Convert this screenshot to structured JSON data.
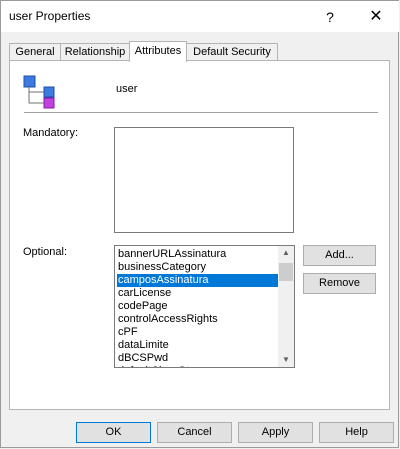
{
  "window": {
    "title": "user Properties",
    "help_glyph": "?",
    "close_glyph": "✕"
  },
  "tabs": [
    {
      "label": "General"
    },
    {
      "label": "Relationship"
    },
    {
      "label": "Attributes",
      "active": true
    },
    {
      "label": "Default Security"
    }
  ],
  "object": {
    "name": "user",
    "icon": "class-hierarchy-icon"
  },
  "mandatory": {
    "label": "Mandatory:",
    "items": []
  },
  "optional": {
    "label": "Optional:",
    "items": [
      "bannerURLAssinatura",
      "businessCategory",
      "camposAssinatura",
      "carLicense",
      "codePage",
      "controlAccessRights",
      "cPF",
      "dataLimite",
      "dBCSPwd",
      "defaultClassStore"
    ],
    "selected": "camposAssinatura"
  },
  "side_buttons": {
    "add": "Add...",
    "remove": "Remove"
  },
  "footer_buttons": {
    "ok": "OK",
    "cancel": "Cancel",
    "apply": "Apply",
    "help": "Help"
  },
  "colors": {
    "selection": "#0078d7",
    "icon_blue": "#3c7ae0",
    "icon_magenta": "#c040e0"
  }
}
